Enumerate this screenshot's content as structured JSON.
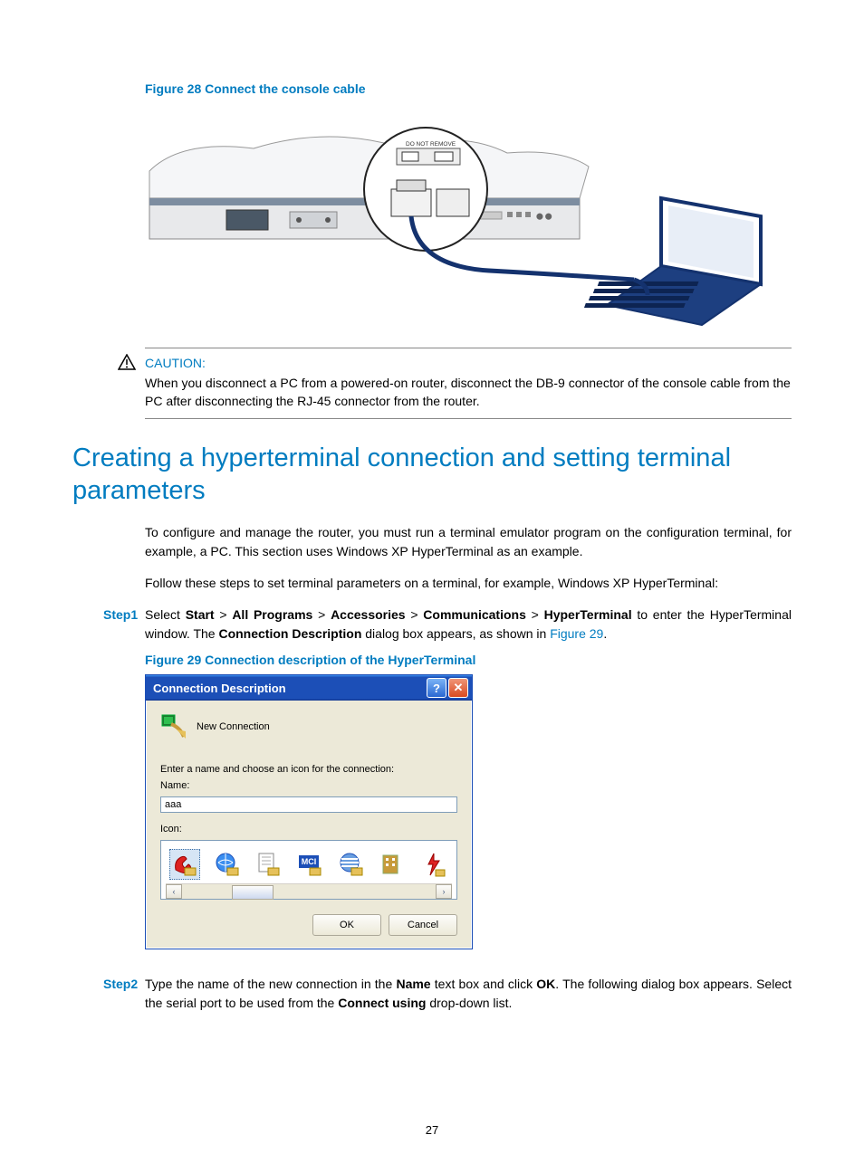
{
  "figure28_caption": "Figure 28 Connect the console cable",
  "figure28_label_on_device": "DO NOT REMOVE",
  "caution": {
    "label": "CAUTION:",
    "text": "When you disconnect a PC from a powered-on router, disconnect the DB-9 connector of the console cable from the PC after disconnecting the RJ-45 connector from the router."
  },
  "section_title": "Creating a hyperterminal connection and setting terminal parameters",
  "para1": "To configure and manage the router, you must run a terminal emulator program on the configuration terminal, for example, a PC. This section uses Windows XP HyperTerminal as an example.",
  "para2": "Follow these steps to set terminal parameters on a terminal, for example, Windows XP HyperTerminal:",
  "step1": {
    "label": "Step1",
    "pre": "Select ",
    "b1": "Start",
    "sep": " > ",
    "b2": "All Programs",
    "b3": "Accessories",
    "b4": "Communications",
    "b5": "HyperTerminal",
    "mid": " to enter the HyperTerminal window. The ",
    "b6": "Connection Description",
    "post": " dialog box appears, as shown in ",
    "link": "Figure 29",
    "end": "."
  },
  "figure29_caption": "Figure 29 Connection description of the HyperTerminal",
  "dialog": {
    "title": "Connection Description",
    "help_btn": "?",
    "close_btn": "✕",
    "newconn_label": "New Connection",
    "prompt": "Enter a name and choose an icon for the connection:",
    "name_label": "Name:",
    "name_value": "aaa",
    "icon_label": "Icon:",
    "icon_mci": "MCI",
    "scroll_left": "‹",
    "scroll_right": "›",
    "ok": "OK",
    "cancel": "Cancel"
  },
  "step2": {
    "label": "Step2",
    "pre": "Type the name of the new connection in the ",
    "b1": "Name",
    "mid1": " text box and click ",
    "b2": "OK",
    "mid2": ". The following dialog box appears. Select the serial port to be used from the ",
    "b3": "Connect using",
    "post": " drop-down list."
  },
  "page_number": "27"
}
